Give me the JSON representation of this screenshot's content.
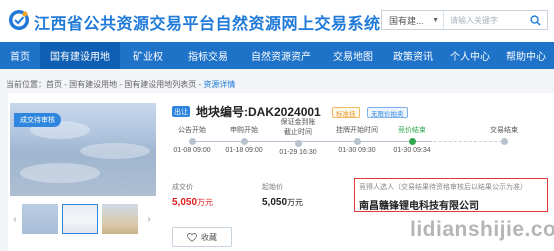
{
  "header": {
    "title": "江西省公共资源交易平台自然资源网上交易系统",
    "search": {
      "category": "国有建...",
      "placeholder": "请输入关键字"
    }
  },
  "nav": {
    "items": [
      {
        "label": "首页",
        "active": false
      },
      {
        "label": "国有建设用地",
        "active": true
      },
      {
        "label": "矿业权",
        "active": false
      },
      {
        "label": "指标交易",
        "active": false
      },
      {
        "label": "自然资源资产",
        "active": false
      },
      {
        "label": "交易地图",
        "active": false
      },
      {
        "label": "政策资讯",
        "active": false
      },
      {
        "label": "个人中心",
        "active": false
      },
      {
        "label": "帮助中心",
        "active": false
      }
    ]
  },
  "breadcrumb": {
    "prefix": "当前位置：首页 - 国有建设用地 - 国有建设用地列表页 - ",
    "current": "资源详情"
  },
  "listing": {
    "status_tag": "成交待审核",
    "badge": "出让",
    "plot_number": "地块编号:DAK2024001",
    "tag_listing": "标准挂",
    "tag_delay": "无限价拍卖",
    "timeline": [
      {
        "label": "公告开始",
        "date": "01-08 09:00",
        "done": false
      },
      {
        "label": "申购开始",
        "date": "01-18 09:00",
        "done": false
      },
      {
        "label": "保证金到账截止时间",
        "label_line1": "保证金到账",
        "label_line2": "截止时间",
        "date": "01-29 16:30",
        "done": false
      },
      {
        "label": "挂牌开始时间",
        "date": "01-30 09:30",
        "done": false
      },
      {
        "label": "竞价结束",
        "date": "01-30 09:34",
        "done": true
      },
      {
        "label": "交易结束",
        "date": "",
        "done": false
      }
    ],
    "deal_price_label": "成交价",
    "deal_price_value": "5,050",
    "deal_price_unit": "万元",
    "start_price_label": "起始价",
    "start_price_value": "5,050",
    "start_price_unit": "万元",
    "winner_label": "竞得人选人（交易结果待资格审核后以结果公示为准）",
    "winner_name": "南昌赣锋锂电科技有限公司",
    "favorite_label": "收藏"
  },
  "watermark": "lidianshijie.com",
  "colors": {
    "brand_blue": "#1e73c9",
    "price_red": "#e02020",
    "done_green": "#2fa84f",
    "winner_border": "#e23a3a"
  }
}
